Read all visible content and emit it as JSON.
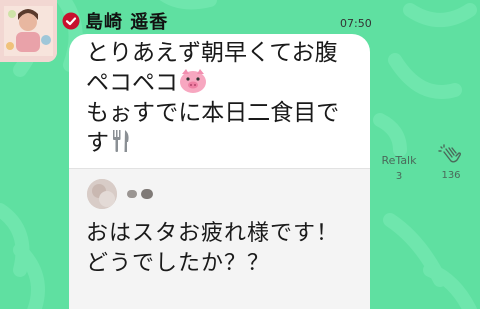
{
  "post": {
    "sender_name": "島崎 遥香",
    "time": "07:50",
    "message_lines": [
      "とりあえず朝早くてお腹",
      "ペコペコ",
      "もぉすでに本日二食目で",
      "す"
    ],
    "emojis": [
      "pig-face-icon",
      "fork-and-knife-icon"
    ]
  },
  "reply": {
    "lines": [
      "おはスタお疲れ様です！",
      "どうでしたか？？"
    ]
  },
  "actions": {
    "retalk_label": "ReTalk",
    "retalk_count": "3",
    "clap_count": "136"
  },
  "colors": {
    "background": "#5fe0a1",
    "bubble": "#ffffff",
    "reply_background": "#f4f4f4",
    "verified_badge": "#c8102e",
    "action_text": "#4a6a5a"
  }
}
